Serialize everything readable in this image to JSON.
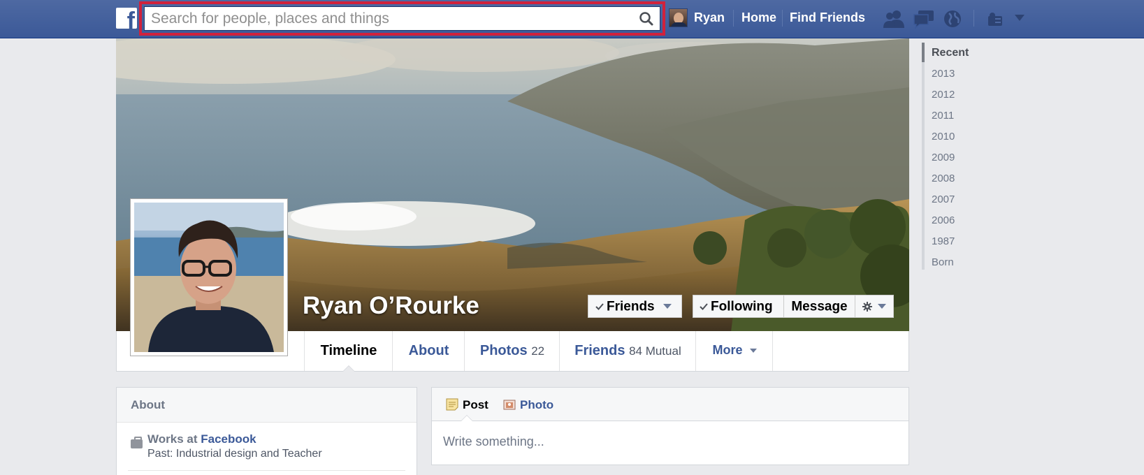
{
  "topbar": {
    "search_placeholder": "Search for people, places and things",
    "user_name": "Ryan",
    "home_label": "Home",
    "find_friends_label": "Find Friends"
  },
  "timeline_nav": {
    "items": [
      "Recent",
      "2013",
      "2012",
      "2011",
      "2010",
      "2009",
      "2008",
      "2007",
      "2006",
      "1987",
      "Born"
    ]
  },
  "profile": {
    "name": "Ryan O’Rourke",
    "friends_button": "Friends",
    "following_button": "Following",
    "message_button": "Message"
  },
  "tabs": {
    "timeline": "Timeline",
    "about": "About",
    "photos": "Photos",
    "photos_count": "22",
    "friends": "Friends",
    "friends_mutual": "84 Mutual",
    "more": "More"
  },
  "about_card": {
    "title": "About",
    "works_prefix": "Works at",
    "employer": "Facebook",
    "past": "Past: Industrial design and Teacher"
  },
  "composer": {
    "post_tab": "Post",
    "photo_tab": "Photo",
    "placeholder": "Write something..."
  },
  "colors": {
    "brand_blue": "#3b5998",
    "search_highlight": "#d0223c",
    "page_background": "#e9eaed"
  }
}
